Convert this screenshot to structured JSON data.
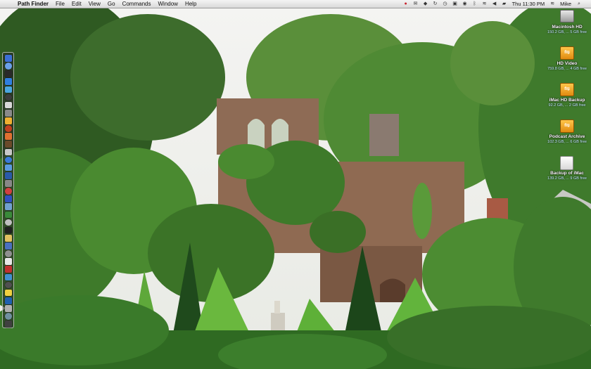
{
  "menubar": {
    "apple": "",
    "app_name": "Path Finder",
    "menus": [
      "File",
      "Edit",
      "View",
      "Go",
      "Commands",
      "Window",
      "Help"
    ],
    "clock": "Thu 11:30 PM",
    "user": "Mike"
  },
  "desktop_icons": [
    {
      "name": "Macintosh HD",
      "info": "150.2 GB, ... 5 GB free",
      "kind": "internal-drive-icon"
    },
    {
      "name": "HD Video",
      "info": "759.8 GB, ... 4 GB free",
      "kind": "external-drive-icon"
    },
    {
      "name": "iMac HD Backup",
      "info": "92.2 GB, ... 2 GB free",
      "kind": "external-drive-icon"
    },
    {
      "name": "Podcast Archive",
      "info": "102.3 GB, ... 6 GB free",
      "kind": "external-drive-icon"
    },
    {
      "name": "Backup of iMac",
      "info": "139.2 GB, ... 9 GB free",
      "kind": "disk-image-icon"
    }
  ],
  "dock_colors": [
    "#3b6fd6",
    "#6aa0e8",
    "#2a2a2a",
    "#2f7fe0",
    "#4aa6e0",
    "#3c3c3c",
    "#d8d8d8",
    "#8a8a8a",
    "#f0b030",
    "#c04020",
    "#e07030",
    "#6a4a2a",
    "#c8c8c8",
    "#3a7ad8",
    "#5a9ae0",
    "#2a5aa8",
    "#888888",
    "#d04040",
    "#3050c0",
    "#70a0d0",
    "#3a8a3a",
    "#c0c0c0",
    "#202020",
    "#e0c060",
    "#4a70c0",
    "#909090",
    "#e8e8e8",
    "#c03030",
    "#4090d0",
    "#505050",
    "#f0d040",
    "#2060b0",
    "#b0b0b0",
    "#7090a0",
    "#404040"
  ],
  "colors": {
    "menubar": "#e6e6e6",
    "sky": "#f2f2ef",
    "foliage": "#3f7a2a",
    "brick": "#8a6a52"
  }
}
